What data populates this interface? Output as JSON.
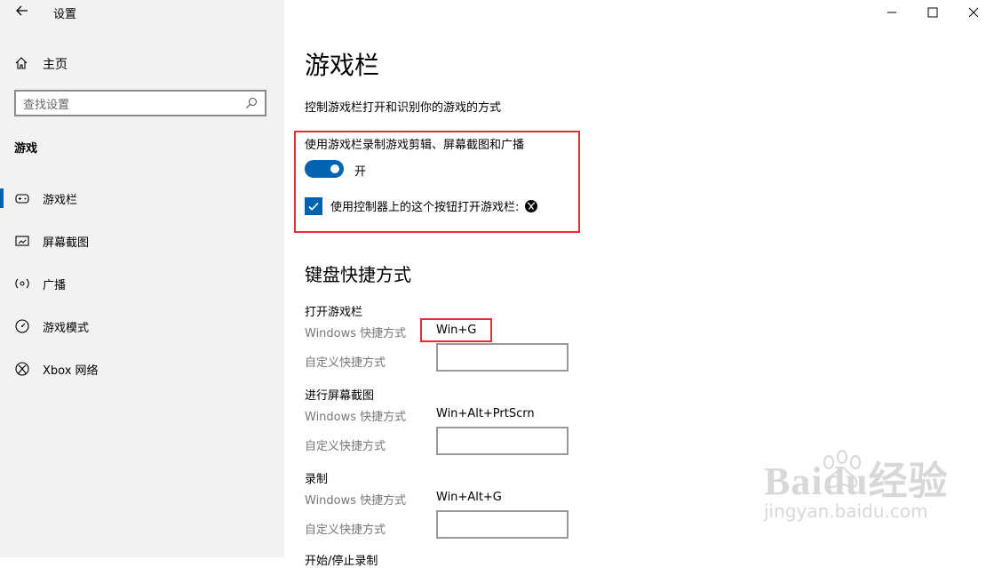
{
  "app": {
    "title": "设置"
  },
  "sidebar": {
    "home_label": "主页",
    "search_placeholder": "查找设置",
    "section_label": "游戏",
    "items": [
      {
        "label": "游戏栏",
        "icon": "gamebar-icon"
      },
      {
        "label": "屏幕截图",
        "icon": "screenshot-icon"
      },
      {
        "label": "广播",
        "icon": "broadcast-icon"
      },
      {
        "label": "游戏模式",
        "icon": "gamemode-icon"
      },
      {
        "label": "Xbox 网络",
        "icon": "xbox-icon"
      }
    ]
  },
  "window_controls": {
    "minimize": "—",
    "maximize": "☐",
    "close": "✕"
  },
  "main": {
    "title": "游戏栏",
    "description": "控制游戏栏打开和识别你的游戏的方式",
    "record_option_label": "使用游戏栏录制游戏剪辑、屏幕截图和广播",
    "toggle_state": "开",
    "controller_checkbox_label": "使用控制器上的这个按钮打开游戏栏:",
    "shortcuts_heading": "键盘快捷方式",
    "windows_shortcut_label": "Windows 快捷方式",
    "custom_shortcut_label": "自定义快捷方式",
    "groups": [
      {
        "title": "打开游戏栏",
        "windows_shortcut": "Win+G"
      },
      {
        "title": "进行屏幕截图",
        "windows_shortcut": "Win+Alt+PrtScrn"
      },
      {
        "title": "录制",
        "windows_shortcut": "Win+Alt+G"
      }
    ],
    "cut_off_text": "开始/停止录制"
  },
  "watermark": {
    "brand": "Baidu经验",
    "url": "jingyan.baidu.com"
  },
  "colors": {
    "accent": "#0063b1",
    "highlight": "#e0313b"
  }
}
